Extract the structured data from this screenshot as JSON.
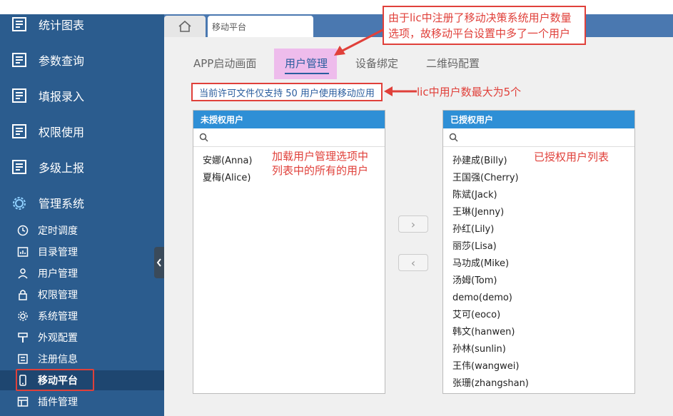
{
  "sidebar": {
    "main_items": [
      {
        "label": "统计图表",
        "icon": "report-icon"
      },
      {
        "label": "参数查询",
        "icon": "report-icon"
      },
      {
        "label": "填报录入",
        "icon": "report-icon"
      },
      {
        "label": "权限使用",
        "icon": "report-icon"
      },
      {
        "label": "多级上报",
        "icon": "report-icon"
      },
      {
        "label": "管理系统",
        "icon": "gear-cluster-icon"
      }
    ],
    "sub_items": [
      {
        "label": "定时调度",
        "icon": "clock-icon"
      },
      {
        "label": "目录管理",
        "icon": "folder-chart-icon"
      },
      {
        "label": "用户管理",
        "icon": "user-icon"
      },
      {
        "label": "权限管理",
        "icon": "lock-icon"
      },
      {
        "label": "系统管理",
        "icon": "gear-icon"
      },
      {
        "label": "外观配置",
        "icon": "brush-icon"
      },
      {
        "label": "注册信息",
        "icon": "register-icon"
      },
      {
        "label": "移动平台",
        "icon": "mobile-icon"
      },
      {
        "label": "插件管理",
        "icon": "plugin-icon"
      }
    ],
    "active_sub": "移动平台"
  },
  "tabs": {
    "current": "移动平台"
  },
  "subtabs": [
    {
      "label": "APP启动画面"
    },
    {
      "label": "用户管理"
    },
    {
      "label": "设备绑定"
    },
    {
      "label": "二维码配置"
    }
  ],
  "license_notice": "当前许可文件仅支持 50 用户使用移动应用",
  "unauthorized": {
    "title": "未授权用户",
    "users": [
      "安娜(Anna)",
      "夏梅(Alice)"
    ]
  },
  "authorized": {
    "title": "已授权用户",
    "users": [
      "孙建成(Billy)",
      "王国强(Cherry)",
      "陈斌(Jack)",
      "王琳(Jenny)",
      "孙红(Lily)",
      "丽莎(Lisa)",
      "马功成(Mike)",
      "汤姆(Tom)",
      "demo(demo)",
      "艾可(eoco)",
      "韩文(hanwen)",
      "孙林(sunlin)",
      "王伟(wangwei)",
      "张珊(zhangshan)"
    ]
  },
  "buttons": {
    "move_right": "›",
    "move_left": "‹"
  },
  "annotations": {
    "callout_line1": "由于lic中注册了移动决策系统用户数量",
    "callout_line2": "选项，故移动平台设置中多了一个用户",
    "lic_max": "lic中用户数最大为5个",
    "left_note_line1": "加载用户管理选项中",
    "left_note_line2": "列表中的所有的用户",
    "right_note": "已授权用户列表"
  },
  "colors": {
    "sidebar": "#2b5c8e",
    "accent": "#2e8fd6",
    "annotation": "#e0403a",
    "highlight": "#eebcec"
  }
}
